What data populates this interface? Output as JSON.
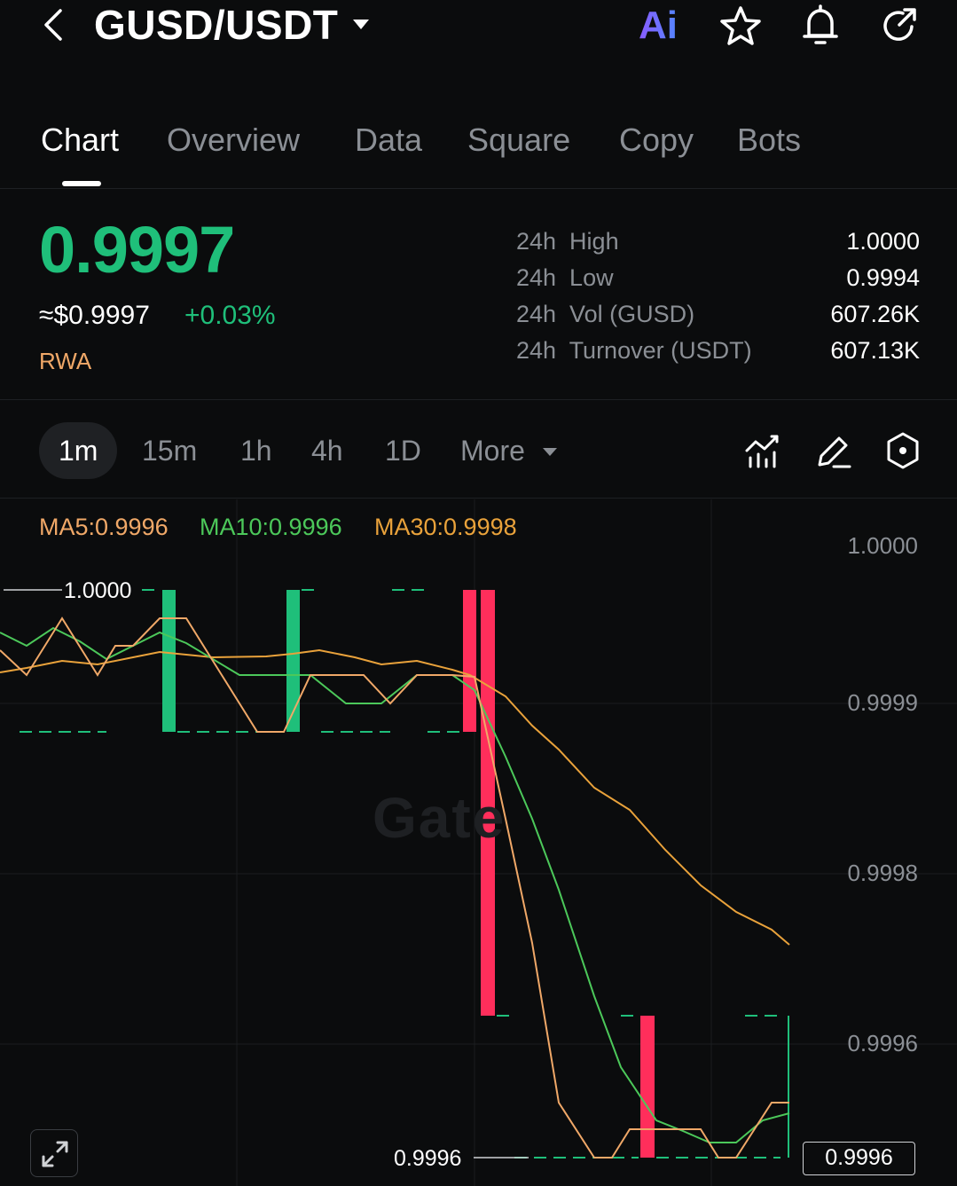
{
  "header": {
    "pair": "GUSD/USDT",
    "ai_label": "Ai",
    "icons": [
      "back-icon",
      "ai-icon",
      "star-icon",
      "bell-icon",
      "share-icon"
    ]
  },
  "tabs": [
    {
      "label": "Chart",
      "active": true
    },
    {
      "label": "Overview",
      "active": false
    },
    {
      "label": "Data",
      "active": false
    },
    {
      "label": "Square",
      "active": false
    },
    {
      "label": "Copy",
      "active": false
    },
    {
      "label": "Bots",
      "active": false
    }
  ],
  "price": {
    "last": "0.9997",
    "fiat": "≈$0.9997",
    "change": "+0.03%",
    "tag": "RWA"
  },
  "stats": [
    {
      "label": "24h  High",
      "value": "1.0000"
    },
    {
      "label": "24h  Low",
      "value": "0.9994"
    },
    {
      "label": "24h  Vol (GUSD)",
      "value": "607.26K"
    },
    {
      "label": "24h  Turnover (USDT)",
      "value": "607.13K"
    }
  ],
  "intervals": {
    "items": [
      "1m",
      "15m",
      "1h",
      "4h",
      "1D"
    ],
    "active": "1m",
    "more": "More"
  },
  "chart_data": {
    "type": "candlestick",
    "legend": {
      "ma5": "MA5:0.9996",
      "ma10": "MA10:0.9996",
      "ma30": "MA30:0.9998"
    },
    "y_ticks": [
      "1.0000",
      "0.9999",
      "0.9998",
      "0.9996"
    ],
    "high_marker": "1.0000",
    "low_marker": "0.9996",
    "last_price": "0.9996",
    "watermark": "Gate",
    "candles_summary": "mostly flat at 0.9999 with green spikes to 1.0000, then red candles dropping to 0.9996",
    "colors": {
      "up": "#1fbf7a",
      "down": "#ff2e5b",
      "ma5": "#f0a868",
      "ma10": "#4cc85a",
      "ma30": "#e9a23b"
    }
  }
}
